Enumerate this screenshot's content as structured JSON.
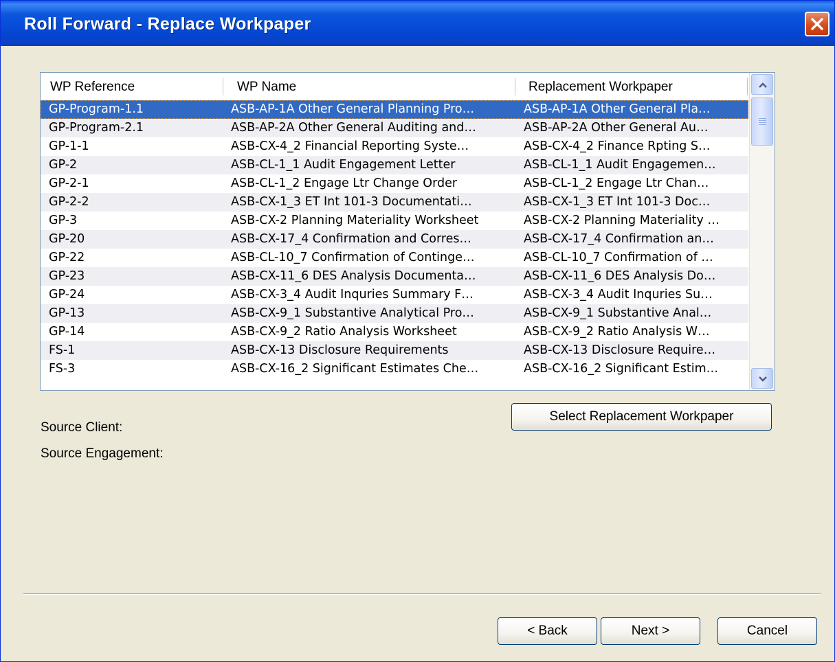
{
  "window": {
    "title": "Roll Forward - Replace Workpaper"
  },
  "table": {
    "columns": [
      "WP Reference",
      "WP Name",
      "Replacement Workpaper"
    ],
    "rows": [
      {
        "ref": "GP-Program-1.1",
        "name": "ASB-AP-1A Other General Planning Pro…",
        "replacement": "ASB-AP-1A Other General Pla…",
        "selected": true
      },
      {
        "ref": "GP-Program-2.1",
        "name": "ASB-AP-2A Other General Auditing and…",
        "replacement": "ASB-AP-2A Other General Au…"
      },
      {
        "ref": "GP-1-1",
        "name": "ASB-CX-4_2 Financial Reporting Syste…",
        "replacement": "ASB-CX-4_2 Finance Rpting S…"
      },
      {
        "ref": "GP-2",
        "name": "ASB-CL-1_1 Audit Engagement Letter",
        "replacement": "ASB-CL-1_1 Audit Engagemen…"
      },
      {
        "ref": "GP-2-1",
        "name": "ASB-CL-1_2 Engage Ltr Change Order",
        "replacement": "ASB-CL-1_2 Engage Ltr Chan…"
      },
      {
        "ref": "GP-2-2",
        "name": "ASB-CX-1_3 ET Int 101-3 Documentati…",
        "replacement": "ASB-CX-1_3 ET Int 101-3 Doc…"
      },
      {
        "ref": "GP-3",
        "name": "ASB-CX-2 Planning Materiality Worksheet",
        "replacement": "ASB-CX-2 Planning Materiality …"
      },
      {
        "ref": "GP-20",
        "name": "ASB-CX-17_4 Confirmation and Corres…",
        "replacement": "ASB-CX-17_4 Confirmation an…"
      },
      {
        "ref": "GP-22",
        "name": "ASB-CL-10_7 Confirmation of Continge…",
        "replacement": "ASB-CL-10_7 Confirmation of …"
      },
      {
        "ref": "GP-23",
        "name": "ASB-CX-11_6 DES Analysis Documenta…",
        "replacement": "ASB-CX-11_6 DES Analysis Do…"
      },
      {
        "ref": "GP-24",
        "name": "ASB-CX-3_4 Audit Inquries Summary F…",
        "replacement": "ASB-CX-3_4 Audit Inquries Su…"
      },
      {
        "ref": "GP-13",
        "name": "ASB-CX-9_1 Substantive Analytical Pro…",
        "replacement": "ASB-CX-9_1 Substantive Anal…"
      },
      {
        "ref": "GP-14",
        "name": "ASB-CX-9_2 Ratio Analysis Worksheet",
        "replacement": "ASB-CX-9_2 Ratio Analysis W…"
      },
      {
        "ref": "FS-1",
        "name": "ASB-CX-13 Disclosure Requirements",
        "replacement": "ASB-CX-13 Disclosure Require…"
      },
      {
        "ref": "FS-3",
        "name": "ASB-CX-16_2 Significant Estimates Che…",
        "replacement": "ASB-CX-16_2 Significant Estim…"
      }
    ]
  },
  "labels": {
    "source_client": "Source Client:",
    "source_engagement": "Source Engagement:"
  },
  "buttons": {
    "select_replacement": "Select Replacement Workpaper",
    "back": "< Back",
    "next": "Next >",
    "cancel": "Cancel"
  },
  "icons": {
    "close": "close-icon",
    "scroll_up": "chevron-up-icon",
    "scroll_down": "chevron-down-icon"
  },
  "colors": {
    "title_bar": "#0a52dc",
    "selection": "#316ac5",
    "dialog_bg": "#ece9d8",
    "close_button": "#d64b1b"
  }
}
